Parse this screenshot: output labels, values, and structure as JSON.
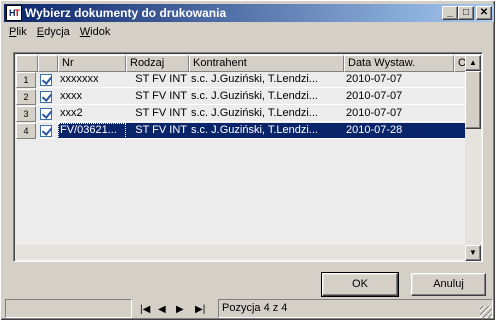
{
  "window": {
    "title": "Wybierz dokumenty do drukowania",
    "icon_letters": [
      "H",
      "T"
    ],
    "controls": [
      "minimize-icon",
      "maximize-icon",
      "close-icon"
    ]
  },
  "menu": [
    {
      "label": "Plik"
    },
    {
      "label": "Edycja"
    },
    {
      "label": "Widok"
    }
  ],
  "grid": {
    "columns": [
      "Nr",
      "Rodzaj",
      "Kontrahent",
      "Data Wystaw.",
      "O"
    ],
    "rows": [
      {
        "num": "1",
        "checked": true,
        "nr": "xxxxxxx",
        "rodzaj": "ST FV INT",
        "kontrahent": "s.c. J.Guziński, T.Lendzi...",
        "data": "2010-07-07",
        "selected": false
      },
      {
        "num": "2",
        "checked": true,
        "nr": "xxxx",
        "rodzaj": "ST FV INT",
        "kontrahent": "s.c. J.Guziński, T.Lendzi...",
        "data": "2010-07-07",
        "selected": false
      },
      {
        "num": "3",
        "checked": true,
        "nr": "xxx2",
        "rodzaj": "ST FV INT",
        "kontrahent": "s.c. J.Guziński, T.Lendzi...",
        "data": "2010-07-07",
        "selected": false
      },
      {
        "num": "4",
        "checked": true,
        "nr": "FV/03621...",
        "rodzaj": "ST FV INT",
        "kontrahent": "s.c. J.Guziński, T.Lendzi...",
        "data": "2010-07-28",
        "selected": true
      }
    ]
  },
  "buttons": {
    "ok": "OK",
    "cancel": "Anuluj"
  },
  "navigator": {
    "first": "◀",
    "prev": "◀",
    "next": "▶",
    "last": "▶"
  },
  "status": {
    "position": "Pozycja 4 z 4"
  },
  "colors": {
    "selection": "#0a246a",
    "title_start": "#0a246a",
    "title_end": "#a6caf0",
    "face": "#d4d0c8"
  }
}
